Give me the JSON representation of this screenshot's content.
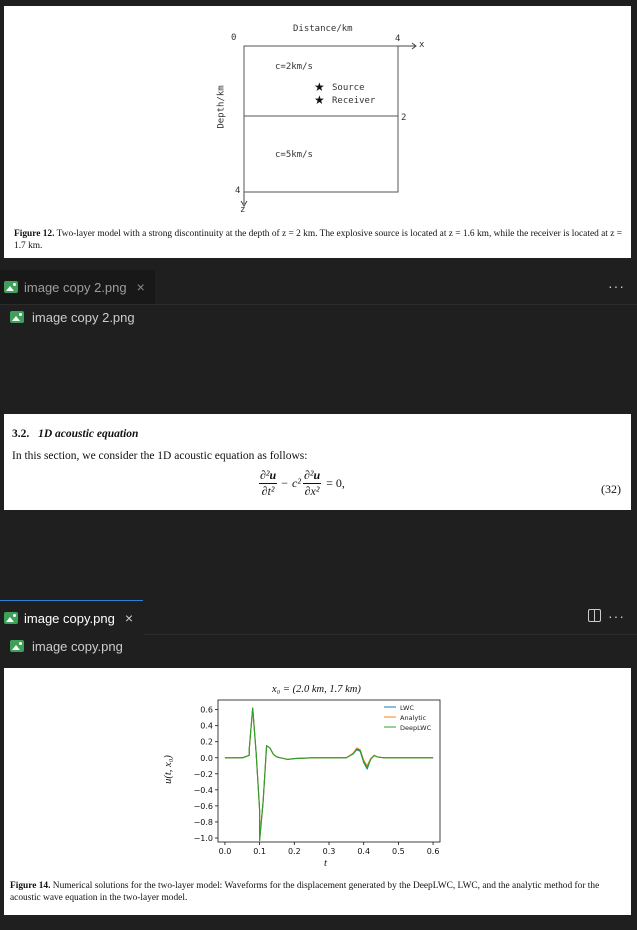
{
  "figure12": {
    "distance_label": "Distance/km",
    "depth_label": "Depth/km",
    "tick_x0": "0",
    "tick_x4": "4",
    "x_axis": "x",
    "tick_z2": "2",
    "tick_z4": "4",
    "z_axis": "z",
    "layer1": "c=2km/s",
    "layer2": "c=5km/s",
    "source": "Source",
    "receiver": "Receiver",
    "star_glyph": "★",
    "caption_bold": "Figure 12.",
    "caption_text": "Two-layer model with a strong discontinuity at the depth of z = 2 km. The explosive source is located at z = 1.6 km, while the receiver is located at z = 1.7 km."
  },
  "tab1": {
    "name": "image copy 2.png",
    "close": "×",
    "more": "···"
  },
  "breadcrumb1": {
    "name": "image copy 2.png"
  },
  "section": {
    "heading_num": "3.2.",
    "heading_title": "1D acoustic equation",
    "body": "In this section, we consider the 1D acoustic equation as follows:",
    "eq_number": "(32)"
  },
  "tab2": {
    "name": "image copy.png",
    "close": "×",
    "more": "···"
  },
  "breadcrumb2": {
    "name": "image copy.png"
  },
  "figure14": {
    "caption_bold": "Figure 14.",
    "caption_text": "Numerical solutions for the two-layer model: Waveforms for the displacement generated by the DeepLWC, LWC, and the analytic method for the acoustic wave equation in the two-layer model."
  },
  "chart_data": {
    "type": "line",
    "title": "x₀ = (2.0 km, 1.7 km)",
    "xlabel": "t",
    "ylabel": "u(t, x₀)",
    "xlim": [
      -0.02,
      0.62
    ],
    "ylim": [
      -1.05,
      0.72
    ],
    "x_ticks": [
      "0.0",
      "0.1",
      "0.2",
      "0.3",
      "0.4",
      "0.5",
      "0.6"
    ],
    "y_ticks": [
      "0.6",
      "0.4",
      "0.2",
      "0.0",
      "−0.2",
      "−0.4",
      "−0.6",
      "−0.8",
      "−1.0"
    ],
    "legend_position": "top-right",
    "grid": false,
    "series": [
      {
        "name": "LWC",
        "color": "#1f77b4",
        "x": [
          0.0,
          0.05,
          0.07,
          0.07,
          0.08,
          0.09,
          0.1,
          0.1,
          0.11,
          0.12,
          0.13,
          0.14,
          0.15,
          0.18,
          0.2,
          0.25,
          0.3,
          0.35,
          0.37,
          0.38,
          0.39,
          0.4,
          0.41,
          0.42,
          0.43,
          0.44,
          0.46,
          0.5,
          0.55,
          0.6
        ],
        "y": [
          0.0,
          0.0,
          0.03,
          0.1,
          0.62,
          0.05,
          -0.65,
          -1.03,
          -0.55,
          0.15,
          0.12,
          0.04,
          0.01,
          -0.02,
          -0.01,
          0.0,
          0.0,
          0.0,
          0.05,
          0.1,
          0.08,
          -0.06,
          -0.14,
          -0.02,
          0.03,
          0.01,
          0.0,
          0.0,
          0.0,
          0.0
        ]
      },
      {
        "name": "Analytic",
        "color": "#ff7f0e",
        "x": [
          0.0,
          0.05,
          0.07,
          0.07,
          0.08,
          0.09,
          0.1,
          0.1,
          0.11,
          0.12,
          0.13,
          0.14,
          0.15,
          0.18,
          0.2,
          0.25,
          0.3,
          0.35,
          0.37,
          0.38,
          0.39,
          0.4,
          0.41,
          0.42,
          0.43,
          0.44,
          0.46,
          0.5,
          0.55,
          0.6
        ],
        "y": [
          0.0,
          0.0,
          0.03,
          0.1,
          0.62,
          0.05,
          -0.65,
          -1.03,
          -0.55,
          0.15,
          0.12,
          0.04,
          0.01,
          -0.02,
          -0.01,
          0.0,
          0.0,
          0.0,
          0.06,
          0.12,
          0.1,
          -0.03,
          -0.1,
          -0.01,
          0.03,
          0.01,
          0.0,
          0.0,
          0.0,
          0.0
        ]
      },
      {
        "name": "DeepLWC",
        "color": "#2ca02c",
        "x": [
          0.0,
          0.05,
          0.07,
          0.07,
          0.08,
          0.09,
          0.1,
          0.1,
          0.11,
          0.12,
          0.13,
          0.14,
          0.15,
          0.18,
          0.2,
          0.25,
          0.3,
          0.35,
          0.37,
          0.38,
          0.39,
          0.4,
          0.41,
          0.42,
          0.43,
          0.44,
          0.46,
          0.5,
          0.55,
          0.6
        ],
        "y": [
          0.0,
          0.0,
          0.03,
          0.1,
          0.62,
          0.05,
          -0.65,
          -1.03,
          -0.55,
          0.15,
          0.12,
          0.04,
          0.01,
          -0.02,
          -0.01,
          0.0,
          0.0,
          0.0,
          0.05,
          0.11,
          0.09,
          -0.05,
          -0.12,
          -0.02,
          0.03,
          0.01,
          0.0,
          0.0,
          0.0,
          0.0
        ]
      }
    ]
  }
}
